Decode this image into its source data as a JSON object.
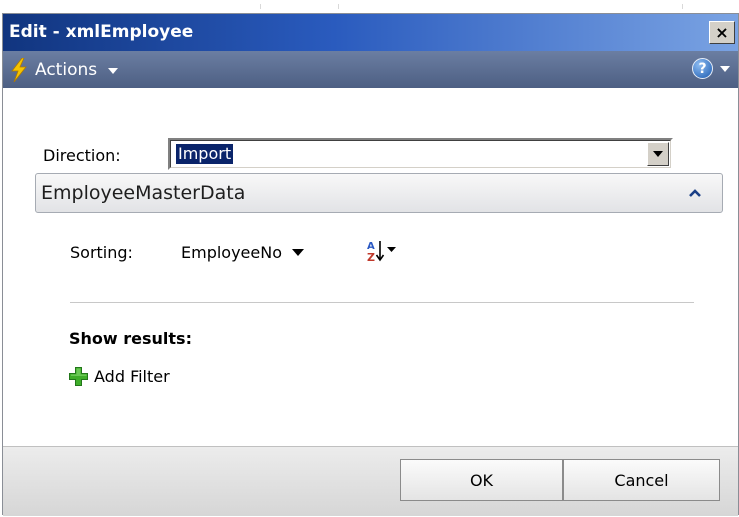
{
  "window": {
    "title": "Edit - xmlEmployee",
    "close_glyph": "×"
  },
  "actionbar": {
    "actions_label": "Actions",
    "help_glyph": "?"
  },
  "form": {
    "direction_label": "Direction:",
    "direction_value": "Import"
  },
  "section": {
    "title": "EmployeeMasterData",
    "sorting_label": "Sorting:",
    "sorting_field": "EmployeeNo",
    "show_results_label": "Show results:",
    "add_filter_label": "Add Filter"
  },
  "footer": {
    "ok_label": "OK",
    "cancel_label": "Cancel"
  },
  "icons": {
    "actions": "lightning-icon",
    "help": "help-icon",
    "sort": "sort-ascending-icon",
    "add": "plus-icon",
    "collapse": "chevron-up-icon"
  },
  "colors": {
    "title_bar_start": "#11357f",
    "title_bar_end": "#7aa3e3",
    "action_bar": "#5a6d92",
    "selection": "#0a246a",
    "plus_green": "#3fae2a",
    "bolt_yellow": "#f5c400"
  }
}
